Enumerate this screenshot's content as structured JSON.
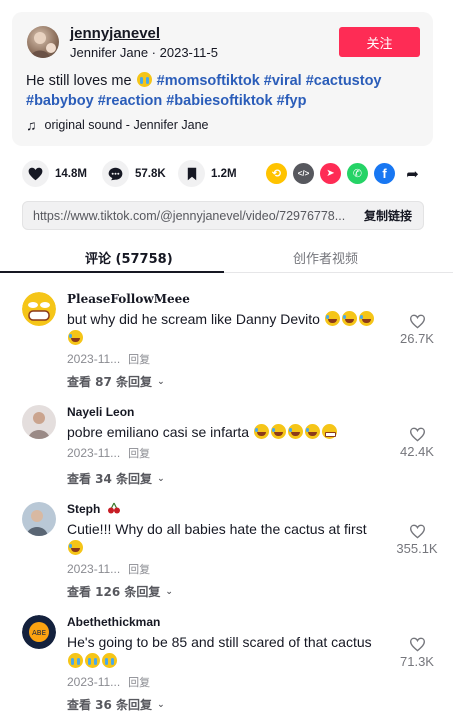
{
  "post": {
    "username": "jennyjanevel",
    "display_name": "Jennifer Jane",
    "separator": " · ",
    "date": "2023-11-5",
    "follow_label": "关注",
    "caption_text": "He still loves me",
    "hashtags": [
      "#momsoftiktok",
      "#viral",
      "#cactustoy",
      "#babyboy",
      "#reaction",
      "#babiesoftiktok",
      "#fyp"
    ],
    "sound": "original sound - Jennifer Jane"
  },
  "actions": {
    "likes": "14.8M",
    "comments": "57.8K",
    "saves": "1.2M"
  },
  "share_icons": [
    {
      "name": "repost-icon",
      "color": "#ffc300",
      "glyph": "⟲"
    },
    {
      "name": "embed-icon",
      "color": "#57585e",
      "glyph": "</>"
    },
    {
      "name": "send-icon",
      "color": "#fe2c55",
      "glyph": "➤"
    },
    {
      "name": "whatsapp-icon",
      "color": "#25d366",
      "glyph": "✆"
    },
    {
      "name": "facebook-icon",
      "color": "#1877f2",
      "glyph": "f"
    }
  ],
  "link": {
    "url": "https://www.tiktok.com/@jennyjanevel/video/72976778...",
    "copy_label": "复制链接"
  },
  "tabs": {
    "comments": "评论 (57758)",
    "creator_videos": "创作者视频"
  },
  "comments": [
    {
      "name": "PleaseFollowMeee",
      "text": "but why did he scream like Danny Devito",
      "date": "2023-11...",
      "reply": "回复",
      "view_replies": "查看 87 条回复",
      "likes": "26.7K"
    },
    {
      "name": "Nayeli Leon",
      "text": "pobre emiliano casi se infarta",
      "date": "2023-11...",
      "reply": "回复",
      "view_replies": "查看 34 条回复",
      "likes": "42.4K"
    },
    {
      "name": "Steph",
      "text": "Cutie!!! Why do all babies hate the cactus at first",
      "date": "2023-11...",
      "reply": "回复",
      "view_replies": "查看 126 条回复",
      "likes": "355.1K"
    },
    {
      "name": "Abethethickman",
      "text": "He's going to be 85 and still scared of that cactus",
      "date": "2023-11...",
      "reply": "回复",
      "view_replies": "查看 36 条回复",
      "likes": "71.3K"
    }
  ],
  "colors": {
    "accent": "#fe2c55",
    "hashtag": "#2b5db9",
    "text": "#161823",
    "muted": "#8a8b91"
  }
}
